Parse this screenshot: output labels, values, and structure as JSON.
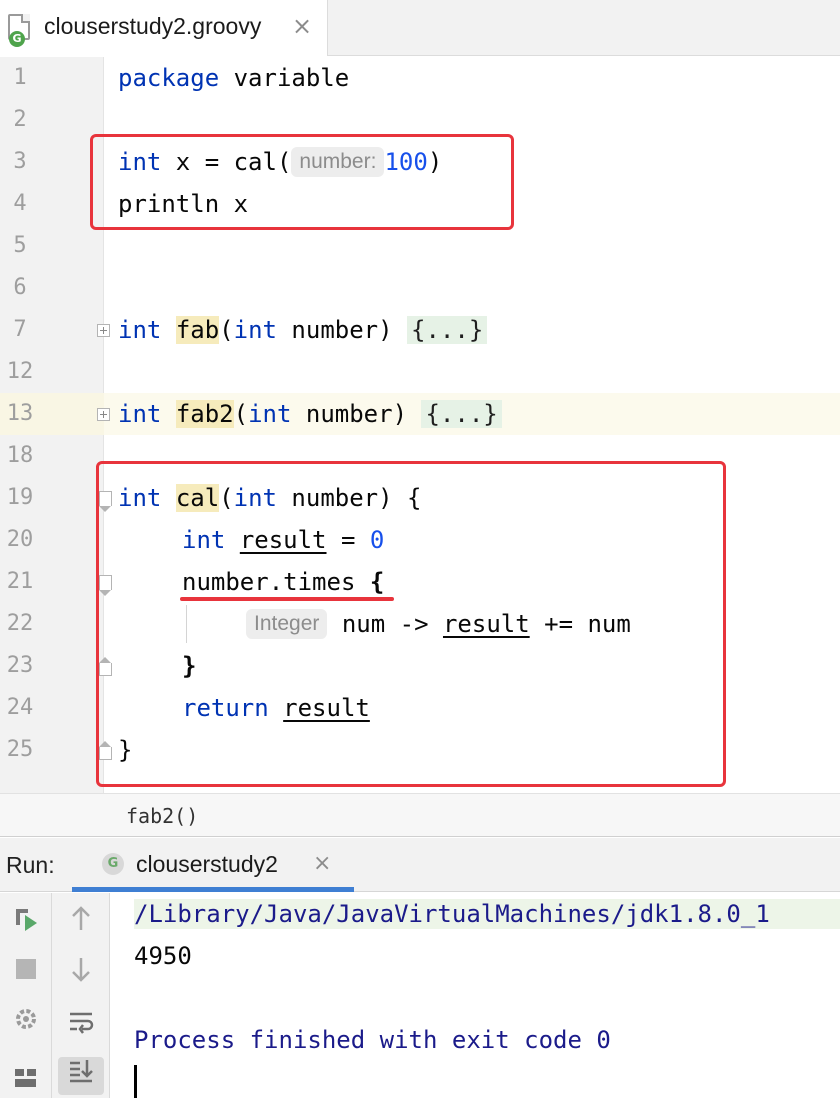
{
  "editor_tab": {
    "filename": "clouserstudy2.groovy",
    "badge": "G",
    "close": "×"
  },
  "code_lines": [
    {
      "num": "1",
      "text": "package variable"
    },
    {
      "num": "2",
      "text": ""
    },
    {
      "num": "3",
      "text": "int x = cal(",
      "hint": "number:",
      "value": "100",
      "end": ")"
    },
    {
      "num": "4",
      "text": "println x"
    },
    {
      "num": "5",
      "text": ""
    },
    {
      "num": "6",
      "text": ""
    },
    {
      "num": "7",
      "text": "int fab(int number) {...}"
    },
    {
      "num": "12",
      "text": ""
    },
    {
      "num": "13",
      "text": "int fab2(int number) {...}"
    },
    {
      "num": "18",
      "text": ""
    },
    {
      "num": "19",
      "text": "int cal(int number) {"
    },
    {
      "num": "20",
      "text": "int result = 0"
    },
    {
      "num": "21",
      "text": "number.times {"
    },
    {
      "num": "22",
      "hint": "Integer",
      "text": "num -> result += num"
    },
    {
      "num": "23",
      "text": "}"
    },
    {
      "num": "24",
      "text": "return result"
    },
    {
      "num": "25",
      "text": "}"
    }
  ],
  "tokens": {
    "package": "package",
    "variable": " variable",
    "int": "int",
    "x_assign": " x = cal(",
    "paren_close": ")",
    "println": "println x",
    "fab": "fab",
    "fab2": "fab2",
    "cal": "cal",
    "paren_open": "(",
    "number_param": " number) ",
    "folded": "{...}",
    "open_brace": " {",
    "result": "result",
    "eq_zero_eq": " = ",
    "zero": "0",
    "number_times": "number.times",
    "brace": " {",
    "num_arrow": " num -> ",
    "plus_eq_num": " += num",
    "close_brace": "}",
    "return": "return",
    "space": " "
  },
  "breadcrumb": "fab2()",
  "run_panel": {
    "label": "Run:",
    "tab_label": "clouserstudy2",
    "tab_badge": "G",
    "close": "×",
    "output": [
      "/Library/Java/JavaVirtualMachines/jdk1.8.0_1",
      "4950",
      "",
      "Process finished with exit code 0"
    ]
  },
  "toolbar_icons": [
    "rerun-icon",
    "stop-icon",
    "settings-icon",
    "layout-icon",
    "scroll-up-icon",
    "scroll-down-icon",
    "soft-wrap-icon",
    "scroll-to-end-icon"
  ],
  "colors": {
    "keyword": "#0033b3",
    "number": "#1750eb",
    "annotation_red": "#e8343c",
    "run_tab_underline": "#3f7fd3"
  }
}
